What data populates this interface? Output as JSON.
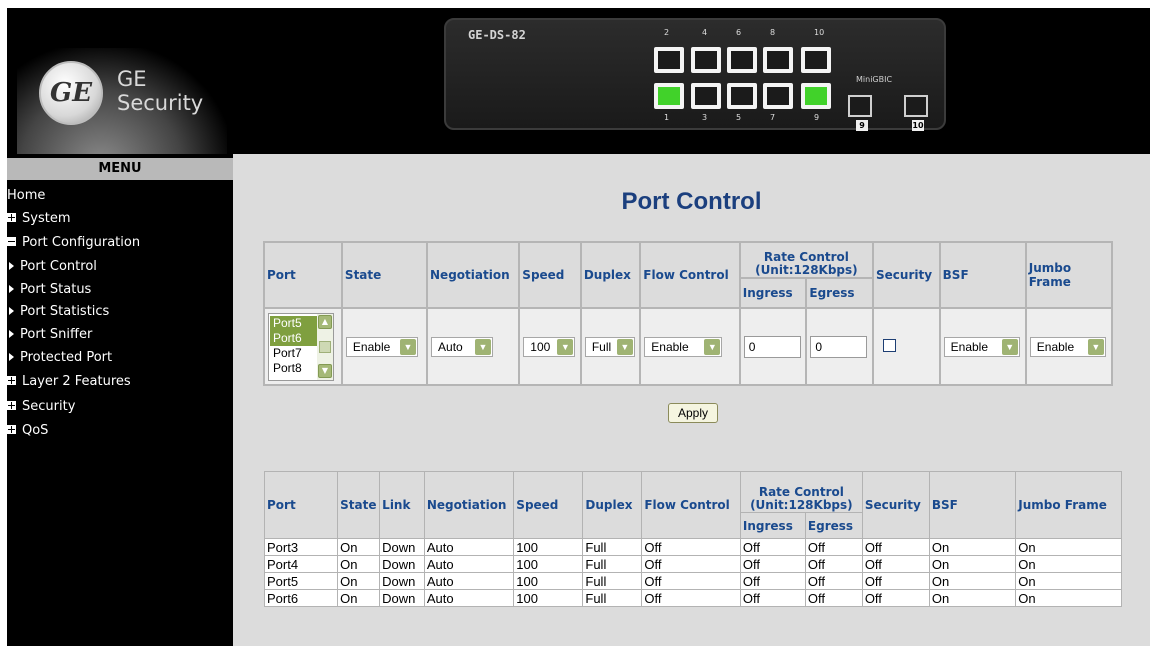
{
  "header": {
    "brand_line1": "GE",
    "brand_line2": "Security",
    "logo_monogram": "GE",
    "device_name": "GE-DS-82",
    "top_port_numbers": [
      "2",
      "4",
      "6",
      "8",
      "10"
    ],
    "bottom_port_numbers": [
      "1",
      "3",
      "5",
      "7",
      "9"
    ],
    "minigbic_label": "MiniGBIC",
    "sfp_numbers": [
      "9",
      "10"
    ],
    "lit_ports": [
      "1",
      "9"
    ]
  },
  "sidebar": {
    "title": "MENU",
    "items": [
      {
        "label": "Home"
      },
      {
        "label": "System"
      },
      {
        "label": "Port Configuration"
      },
      {
        "label": "Port Control"
      },
      {
        "label": "Port Status"
      },
      {
        "label": "Port Statistics"
      },
      {
        "label": "Port Sniffer"
      },
      {
        "label": "Protected Port"
      },
      {
        "label": "Layer 2 Features"
      },
      {
        "label": "Security"
      },
      {
        "label": "QoS"
      }
    ]
  },
  "page": {
    "title": "Port Control"
  },
  "control_table": {
    "headers": {
      "port": "Port",
      "state": "State",
      "negotiation": "Negotiation",
      "speed": "Speed",
      "duplex": "Duplex",
      "flow_control": "Flow Control",
      "rate_control": "Rate Control",
      "rate_unit": "(Unit:128Kbps)",
      "ingress": "Ingress",
      "egress": "Egress",
      "security": "Security",
      "bsf": "BSF",
      "jumbo_frame": "Jumbo Frame"
    },
    "port_options": [
      "Port5",
      "Port6",
      "Port7",
      "Port8"
    ],
    "selected_ports": [
      "Port5",
      "Port6"
    ],
    "state_value": "Enable",
    "negotiation_value": "Auto",
    "speed_value": "100",
    "duplex_value": "Full",
    "flow_control_value": "Enable",
    "ingress_value": "0",
    "egress_value": "0",
    "security_checked": false,
    "bsf_value": "Enable",
    "jumbo_frame_value": "Enable",
    "apply_label": "Apply"
  },
  "status_table": {
    "headers": {
      "port": "Port",
      "state": "State",
      "link": "Link",
      "negotiation": "Negotiation",
      "speed": "Speed",
      "duplex": "Duplex",
      "flow_control": "Flow Control",
      "rate_control": "Rate Control",
      "rate_unit": "(Unit:128Kbps)",
      "ingress": "Ingress",
      "egress": "Egress",
      "security": "Security",
      "bsf": "BSF",
      "jumbo_frame": "Jumbo Frame"
    },
    "rows": [
      {
        "port": "Port3",
        "state": "On",
        "link": "Down",
        "negotiation": "Auto",
        "speed": "100",
        "duplex": "Full",
        "flow_control": "Off",
        "ingress": "Off",
        "egress": "Off",
        "security": "Off",
        "bsf": "On",
        "jumbo_frame": "On"
      },
      {
        "port": "Port4",
        "state": "On",
        "link": "Down",
        "negotiation": "Auto",
        "speed": "100",
        "duplex": "Full",
        "flow_control": "Off",
        "ingress": "Off",
        "egress": "Off",
        "security": "Off",
        "bsf": "On",
        "jumbo_frame": "On"
      },
      {
        "port": "Port5",
        "state": "On",
        "link": "Down",
        "negotiation": "Auto",
        "speed": "100",
        "duplex": "Full",
        "flow_control": "Off",
        "ingress": "Off",
        "egress": "Off",
        "security": "Off",
        "bsf": "On",
        "jumbo_frame": "On"
      },
      {
        "port": "Port6",
        "state": "On",
        "link": "Down",
        "negotiation": "Auto",
        "speed": "100",
        "duplex": "Full",
        "flow_control": "Off",
        "ingress": "Off",
        "egress": "Off",
        "security": "Off",
        "bsf": "On",
        "jumbo_frame": "On"
      }
    ]
  },
  "colors": {
    "heading_blue": "#1b3f7e",
    "header_text_blue": "#1a4a8e",
    "selection_green": "#7f9f3f",
    "link_led_green": "#41d22a",
    "panel_gray": "#dcdcdc"
  },
  "icons": {
    "expand": "plus-square-icon",
    "collapse": "minus-square-icon",
    "submenu": "triangle-right-icon",
    "dropdown": "chevron-down-icon"
  }
}
